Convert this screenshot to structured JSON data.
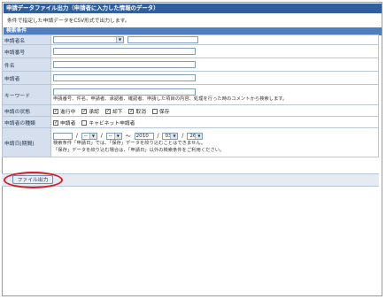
{
  "window": {
    "title": "申請データファイル出力（申請者に入力した情報のデータ）"
  },
  "description": "条件で指定した申請データをCSV形式で出力します。",
  "conditions_header": "検索条件",
  "fields": {
    "applicant_name": {
      "label": "申請者名",
      "select_value": "",
      "input_value": ""
    },
    "application_number": {
      "label": "申請番号",
      "value": ""
    },
    "subject": {
      "label": "件名",
      "value": ""
    },
    "applicant": {
      "label": "申請者",
      "value": ""
    },
    "keyword": {
      "label": "キーワード",
      "value": "",
      "hint": "申請番号、件名、申請者、承認者、確認者、申請した項目の内容、処理を行った時のコメントから検索します。"
    },
    "status": {
      "label": "申請の状態",
      "options": [
        {
          "label": "進行中",
          "checked": true
        },
        {
          "label": "承認",
          "checked": true
        },
        {
          "label": "却下",
          "checked": true
        },
        {
          "label": "取消",
          "checked": true
        },
        {
          "label": "保存",
          "checked": false
        }
      ]
    },
    "applicant_type": {
      "label": "申請者の種類",
      "options": [
        {
          "label": "申請者",
          "checked": true
        },
        {
          "label": "キャビネット申請者",
          "checked": false
        }
      ]
    },
    "application_date": {
      "label": "申請日(期間)",
      "from_year": "",
      "from_month": "--",
      "from_day": "--",
      "tilde": "～",
      "to_year": "2010",
      "to_month": "03",
      "to_day": "26",
      "slash": "/",
      "hint1": "検索条件「申請日」では、「保存」データを絞り込むことはできません。",
      "hint2": "「保存」データを絞り込む場合は、「申請日」以外の検索条件をご利用ください。"
    }
  },
  "footer": {
    "export_button": "ファイル出力"
  },
  "colors": {
    "title_bar": "#2f5f9e",
    "condition_bar": "#4f7fbf",
    "highlight_circle": "#d42027"
  }
}
